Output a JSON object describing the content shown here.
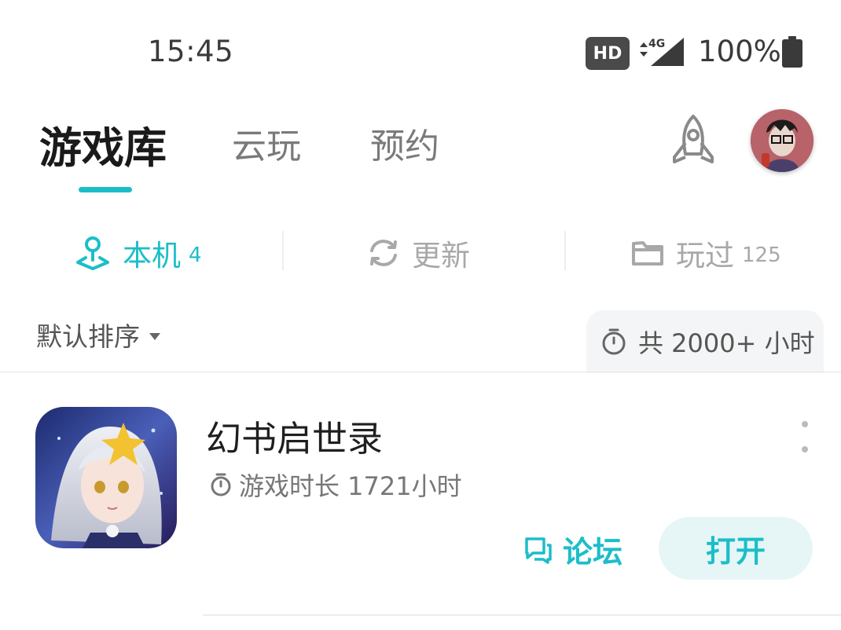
{
  "status_bar": {
    "time": "15:45",
    "hd_badge": "HD",
    "network": "4G",
    "battery": "100%"
  },
  "header": {
    "tabs": [
      {
        "label": "游戏库",
        "active": true
      },
      {
        "label": "云玩",
        "active": false
      },
      {
        "label": "预约",
        "active": false
      }
    ],
    "icons": [
      "rocket-icon",
      "avatar"
    ]
  },
  "subtabs": [
    {
      "icon": "local-device-icon",
      "label": "本机",
      "count": "4",
      "active": true
    },
    {
      "icon": "refresh-icon",
      "label": "更新",
      "count": "",
      "active": false
    },
    {
      "icon": "folder-icon",
      "label": "玩过",
      "count": "125",
      "active": false
    }
  ],
  "sort": {
    "label": "默认排序"
  },
  "total": {
    "text": "共 2000+ 小时"
  },
  "games": [
    {
      "title": "幻书启世录",
      "playtime": "游戏时长 1721小时",
      "forum_label": "论坛",
      "open_label": "打开"
    }
  ],
  "colors": {
    "accent": "#1bbec8",
    "open_button_bg": "#e6f6f7"
  }
}
